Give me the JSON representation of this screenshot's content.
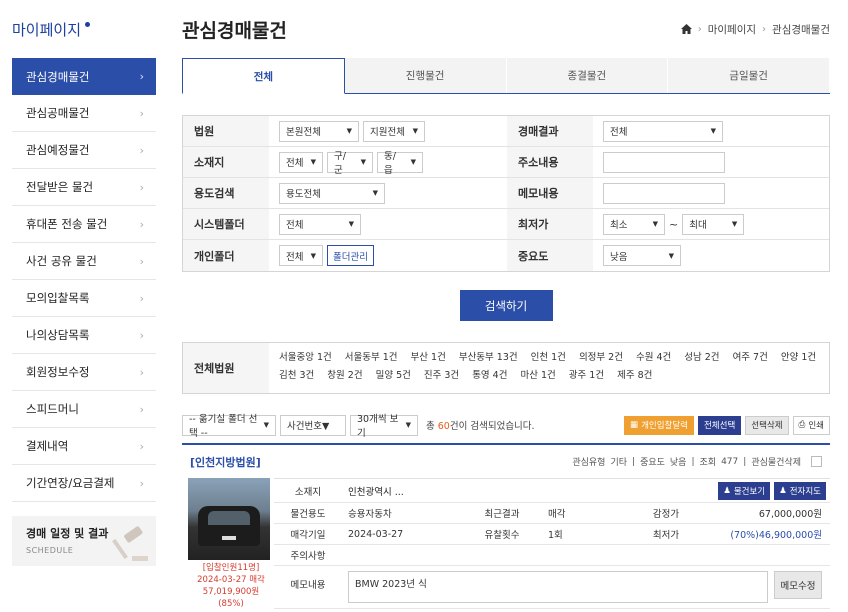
{
  "sidebar": {
    "brand": "마이페이지",
    "items": [
      {
        "label": "관심경매물건",
        "active": true
      },
      {
        "label": "관심공매물건"
      },
      {
        "label": "관심예정물건"
      },
      {
        "label": "전달받은 물건"
      },
      {
        "label": "휴대폰 전송 물건"
      },
      {
        "label": "사건 공유 물건"
      },
      {
        "label": "모의입찰목록"
      },
      {
        "label": "나의상담목록"
      },
      {
        "label": "회원정보수정"
      },
      {
        "label": "스피드머니"
      },
      {
        "label": "결제내역"
      },
      {
        "label": "기간연장/요금결제"
      }
    ],
    "schedule_title": "경매 일정 및 결과",
    "schedule_sub": "SCHEDULE"
  },
  "header": {
    "title": "관심경매물건",
    "breadcrumb": [
      "마이페이지",
      "관심경매물건"
    ]
  },
  "tabs": [
    "전체",
    "진행물건",
    "종결물건",
    "금일물건"
  ],
  "filter": {
    "court_label": "법원",
    "court_sel1": "본원전체",
    "court_sel2": "지원전체",
    "result_label": "경매결과",
    "result_sel": "전체",
    "location_label": "소재지",
    "loc_sel1": "전체",
    "loc_sel2": "구/군",
    "loc_sel3": "동/읍",
    "address_label": "주소내용",
    "usage_label": "용도검색",
    "usage_sel": "용도전체",
    "memo_label": "메모내용",
    "sysfolder_label": "시스템폴더",
    "sysfolder_sel": "전체",
    "minprice_label": "최저가",
    "min_sel": "최소",
    "tilde": "~",
    "max_sel": "최대",
    "folder_label": "개인폴더",
    "folder_sel": "전체",
    "folder_btn": "폴더관리",
    "importance_label": "중요도",
    "importance_sel": "낮음"
  },
  "search_button": "검색하기",
  "courts": {
    "label": "전체법원",
    "items": [
      "서울중앙 1건",
      "서울동부 1건",
      "부산 1건",
      "부산동부 13건",
      "인천 1건",
      "의정부 2건",
      "수원 4건",
      "성남 2건",
      "여주 7건",
      "안양 1건",
      "김천 3건",
      "창원 2건",
      "밀양 5건",
      "진주 3건",
      "통영 4건",
      "마산 1건",
      "광주 1건",
      "제주 8건"
    ]
  },
  "toolbar": {
    "folder_sel": "-- 옮기실 폴더 선택 --",
    "sort_sel": "사건번호▼",
    "perpage_sel": "30개씩 보기",
    "count_prefix": "총 ",
    "count": "60",
    "count_suffix": "건이 검색되었습니다.",
    "btn_bid": "개인입찰달력",
    "btn_selectall": "전체선택",
    "btn_deleteall": "선택삭제",
    "btn_print": "인쇄"
  },
  "item": {
    "court": "[인천지방법원]",
    "meta_type_label": "관심유형",
    "meta_type": "기타",
    "meta_imp_label": "중요도",
    "meta_imp": "낮음",
    "meta_view_label": "조회",
    "meta_view": "477",
    "meta_delete": "관심물건삭제",
    "photo_info1": "[입찰인원11명]",
    "photo_info2": "2024-03-27 매각",
    "photo_info3": "57,019,900원",
    "photo_info4": "(85%)",
    "location_label": "소재지",
    "location_value": "인천광역시 ...",
    "btn_view": "물건보기",
    "btn_map": "전자지도",
    "usage_label": "물건용도",
    "usage_value": "승용자동차",
    "recent_label": "최근결과",
    "recent_value": "매각",
    "appraisal_label": "감정가",
    "appraisal_value": "67,000,000원",
    "date_label": "매각기일",
    "date_value": "2024-03-27",
    "fail_label": "유찰횟수",
    "fail_value": "1회",
    "min_label": "최저가",
    "min_value": "(70%)46,900,000원",
    "notes_label": "주의사항",
    "memo_label": "메모내용",
    "memo_value": "BMW 2023년 식",
    "memo_btn": "메모수정"
  }
}
